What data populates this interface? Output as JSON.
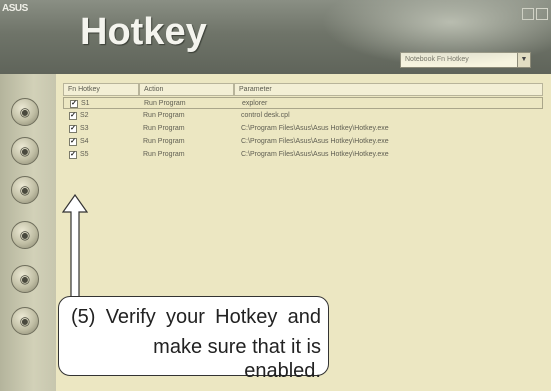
{
  "window": {
    "brand": "ASUS",
    "title": "Hotkey"
  },
  "mode_select": {
    "value": "Notebook Fn Hotkey"
  },
  "table": {
    "headers": [
      "Fn Hotkey",
      "Action",
      "Parameter"
    ],
    "rows": [
      {
        "key": "S1",
        "action": "Run Program",
        "parameter": "explorer",
        "enabled": true
      },
      {
        "key": "S2",
        "action": "Run Program",
        "parameter": "control desk.cpl",
        "enabled": true
      },
      {
        "key": "S3",
        "action": "Run Program",
        "parameter": "C:\\Program Files\\Asus\\Asus Hotkey\\Hotkey.exe",
        "enabled": true
      },
      {
        "key": "S4",
        "action": "Run Program",
        "parameter": "C:\\Program Files\\Asus\\Asus Hotkey\\Hotkey.exe",
        "enabled": true
      },
      {
        "key": "S5",
        "action": "Run Program",
        "parameter": "C:\\Program Files\\Asus\\Asus Hotkey\\Hotkey.exe",
        "enabled": true
      }
    ]
  },
  "sidebar": {
    "buttons": [
      {
        "name": "hotkey-nav-button-1",
        "glyph": "●"
      },
      {
        "name": "hotkey-nav-button-2",
        "glyph": "●"
      },
      {
        "name": "hotkey-nav-button-3",
        "glyph": "●"
      },
      {
        "name": "hotkey-nav-button-4",
        "glyph": "●"
      },
      {
        "name": "hotkey-nav-button-5",
        "glyph": "●"
      },
      {
        "name": "hotkey-nav-button-6",
        "glyph": "●"
      }
    ]
  },
  "callout": {
    "line1": "(5) Verify your Hotkey and",
    "line2": "make sure that it is enabled."
  }
}
